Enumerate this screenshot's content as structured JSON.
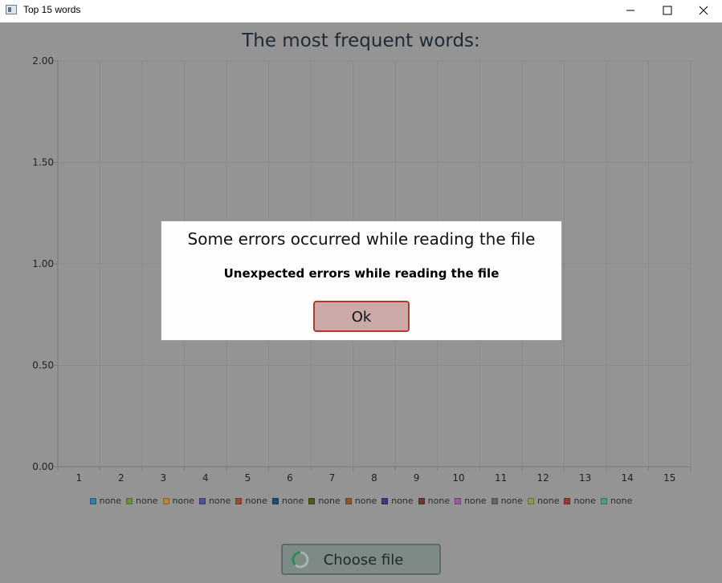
{
  "window": {
    "title": "Top 15 words",
    "controls": [
      "minimize",
      "maximize",
      "close"
    ]
  },
  "chart_data": {
    "type": "bar",
    "title": "The most frequent words:",
    "xlabel": "",
    "ylabel": "",
    "categories": [
      "1",
      "2",
      "3",
      "4",
      "5",
      "6",
      "7",
      "8",
      "9",
      "10",
      "11",
      "12",
      "13",
      "14",
      "15"
    ],
    "yticks": [
      "0.00",
      "0.50",
      "1.00",
      "1.50",
      "2.00"
    ],
    "ylim": [
      0,
      2
    ],
    "grid": true,
    "legend_position": "bottom",
    "series": [
      {
        "name": "none",
        "color": "#2f7fa6",
        "values": []
      },
      {
        "name": "none",
        "color": "#6f8f3c",
        "values": []
      },
      {
        "name": "none",
        "color": "#b5833a",
        "values": []
      },
      {
        "name": "none",
        "color": "#4c4f9c",
        "values": []
      },
      {
        "name": "none",
        "color": "#a04a3c",
        "values": []
      },
      {
        "name": "none",
        "color": "#1e4e70",
        "values": []
      },
      {
        "name": "none",
        "color": "#4a5a1c",
        "values": []
      },
      {
        "name": "none",
        "color": "#8a5a28",
        "values": []
      },
      {
        "name": "none",
        "color": "#3c3a7a",
        "values": []
      },
      {
        "name": "none",
        "color": "#6a3a32",
        "values": []
      },
      {
        "name": "none",
        "color": "#9a5b9a",
        "values": []
      },
      {
        "name": "none",
        "color": "#666666",
        "values": []
      },
      {
        "name": "none",
        "color": "#8a9a4a",
        "values": []
      },
      {
        "name": "none",
        "color": "#9a3a2c",
        "values": []
      },
      {
        "name": "none",
        "color": "#4f9a86",
        "values": []
      }
    ]
  },
  "choose_button": {
    "label": "Choose file",
    "icon": "loading-spinner-icon"
  },
  "dialog": {
    "heading": "Some errors occurred while reading the file",
    "message": "Unexpected errors while reading the file",
    "ok_label": "Ok"
  }
}
